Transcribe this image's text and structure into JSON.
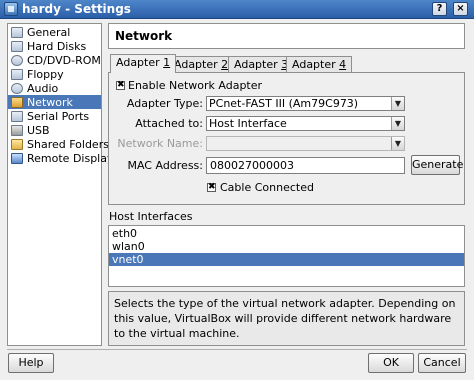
{
  "window": {
    "title": "hardy - Settings",
    "controls": [
      "?",
      "×"
    ]
  },
  "sidebar": {
    "items": [
      {
        "label": "General",
        "icon": "gear-icon",
        "selected": false
      },
      {
        "label": "Hard Disks",
        "icon": "hard-disk-icon",
        "selected": false
      },
      {
        "label": "CD/DVD-ROM",
        "icon": "cd-icon",
        "selected": false
      },
      {
        "label": "Floppy",
        "icon": "floppy-icon",
        "selected": false
      },
      {
        "label": "Audio",
        "icon": "audio-icon",
        "selected": false
      },
      {
        "label": "Network",
        "icon": "network-icon",
        "selected": true
      },
      {
        "label": "Serial Ports",
        "icon": "serial-port-icon",
        "selected": false
      },
      {
        "label": "USB",
        "icon": "usb-icon",
        "selected": false
      },
      {
        "label": "Shared Folders",
        "icon": "folder-icon",
        "selected": false
      },
      {
        "label": "Remote Display",
        "icon": "display-icon",
        "selected": false
      }
    ]
  },
  "page": {
    "title": "Network"
  },
  "tabs": [
    {
      "prefix": "Adapter ",
      "num": "1",
      "active": true
    },
    {
      "prefix": "Adapter ",
      "num": "2",
      "active": false
    },
    {
      "prefix": "Adapter ",
      "num": "3",
      "active": false
    },
    {
      "prefix": "Adapter ",
      "num": "4",
      "active": false
    }
  ],
  "adapter": {
    "enable_label": "Enable Network Adapter",
    "enable_checked": true,
    "type_label": "Adapter Type:",
    "type_value": "PCnet-FAST III (Am79C973)",
    "attached_label": "Attached to:",
    "attached_value": "Host Interface",
    "network_name_label": "Network Name:",
    "network_name_value": "",
    "mac_label": "MAC Address:",
    "mac_value": "080027000003",
    "generate_label": "Generate",
    "cable_label": "Cable Connected",
    "cable_checked": true
  },
  "host_interfaces": {
    "label": "Host Interfaces",
    "items": [
      {
        "name": "eth0",
        "selected": false
      },
      {
        "name": "wlan0",
        "selected": false
      },
      {
        "name": "vnet0",
        "selected": true
      }
    ]
  },
  "description": "Selects the type of the virtual network adapter. Depending on this value, VirtualBox will provide different network hardware to the virtual machine.",
  "footer": {
    "help_label": "Help",
    "ok_label": "OK",
    "cancel_label": "Cancel"
  },
  "colors": {
    "selection": "#4a77b7",
    "titlebar": "#2b5ea8"
  }
}
